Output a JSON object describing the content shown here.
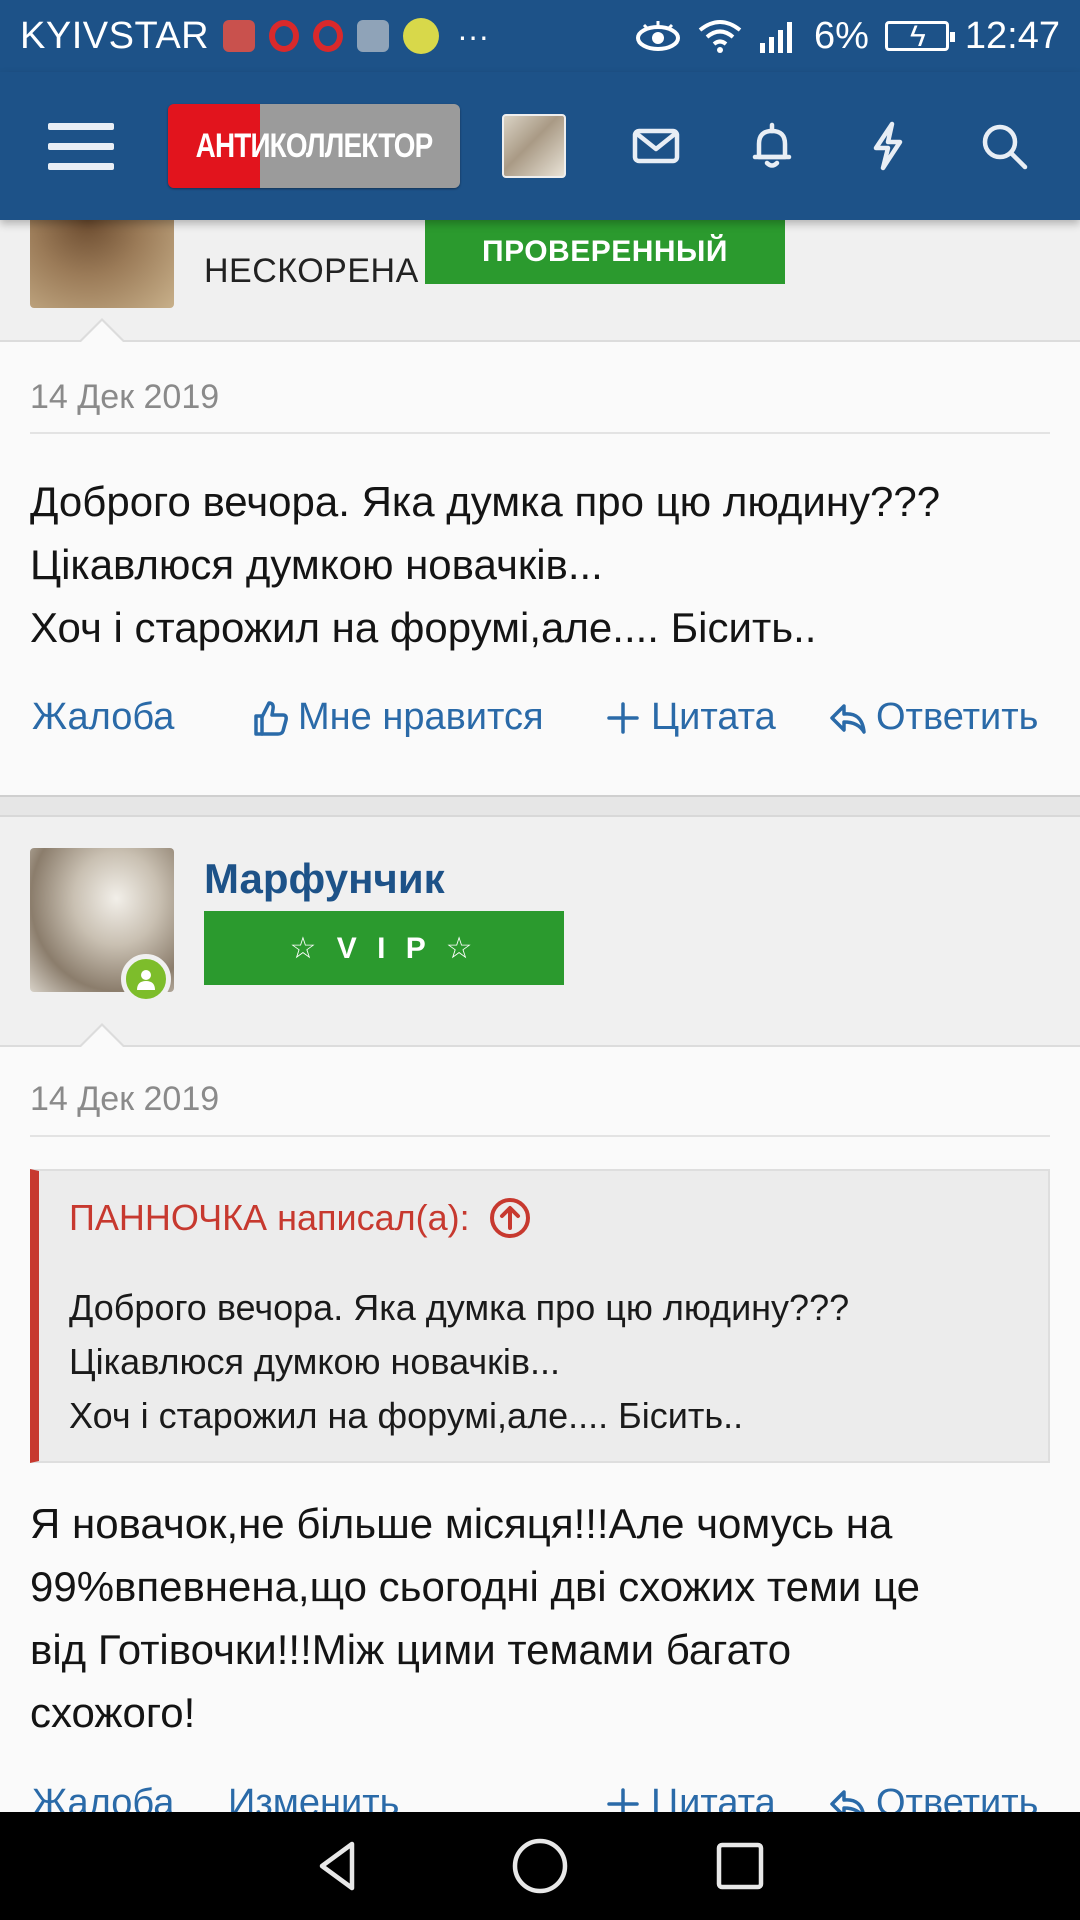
{
  "status_bar": {
    "carrier": "KYIVSTAR",
    "battery_percent": "6%",
    "time": "12:47",
    "more": "···"
  },
  "header": {
    "logo_text": "АНТИКОЛЛЕКТОР",
    "icons": [
      "menu-icon",
      "avatar",
      "mail-icon",
      "bell-icon",
      "lightning-icon",
      "search-icon"
    ]
  },
  "post1": {
    "user_status": "НЕСКОРЕНА",
    "badge": "ПРОВЕРЕННЫЙ",
    "date": "14 Дек 2019",
    "lines": [
      "Доброго вечора. Яка думка про цю людину???",
      "Цікавлюся думкою новачків...",
      "Хоч і старожил на форумі,але.... Бісить.."
    ],
    "actions": {
      "report": "Жалоба",
      "like": "Мне нравится",
      "quote": "Цитата",
      "reply": "Ответить"
    }
  },
  "post2": {
    "username": "Марфунчик",
    "badge": "☆ V I P ☆",
    "date": "14 Дек 2019",
    "quote": {
      "author": "ПАННОЧКА написал(а):",
      "lines": [
        "Доброго вечора. Яка думка про цю людину???",
        "Цікавлюся думкою новачків...",
        "Хоч і старожил на форумі,але.... Бісить.."
      ]
    },
    "lines": [
      "Я новачок,не більше місяця!!!Але чомусь на",
      "99%впевнена,що сьогодні дві схожих теми це",
      "від Готівочки!!!Між цими темами багато",
      "схожого!"
    ],
    "actions": {
      "report": "Жалоба",
      "edit": "Изменить",
      "quote": "Цитата",
      "reply": "Ответить"
    }
  },
  "colors": {
    "header_bg": "#1d5288",
    "badge_green": "#2b9a2e",
    "link_blue": "#2a6aa8",
    "quote_red": "#c7392f",
    "logo_red": "#e2141d"
  }
}
